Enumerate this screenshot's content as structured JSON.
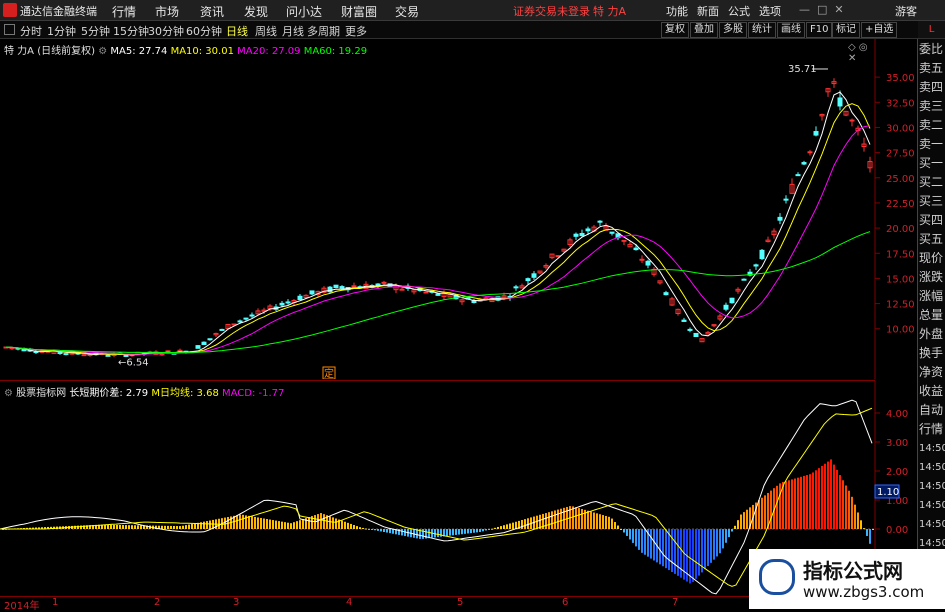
{
  "menubar": {
    "app_title": "通达信金融终端",
    "items": [
      "行情",
      "市场",
      "资讯",
      "发现",
      "问小达",
      "财富圈",
      "交易"
    ],
    "warning": "证券交易未登录",
    "stock": "特 力A",
    "right_items": [
      "功能",
      "新面",
      "公式",
      "选项"
    ],
    "guest": "游客",
    "window_buttons": [
      "—",
      "□",
      "✕"
    ]
  },
  "toolbar": {
    "periods": [
      "分时",
      "1分钟",
      "5分钟",
      "15分钟",
      "30分钟",
      "60分钟",
      "日线",
      "周线",
      "月线",
      "多周期",
      "更多"
    ],
    "active_period": "日线",
    "buttons": [
      "复权",
      "叠加",
      "多股",
      "统计",
      "画线",
      "F10",
      "标记",
      "+自选"
    ]
  },
  "main_chart": {
    "stock_label": "特 力A (日线前复权)",
    "ma5": "MA5: 27.74",
    "ma10": "MA10: 30.01",
    "ma20": "MA20: 27.09",
    "ma60": "MA60: 19.29",
    "high_label": "35.71",
    "low_label": "6.54",
    "marker": "定",
    "price_ticks": [
      "35.00",
      "32.50",
      "30.00",
      "27.50",
      "25.00",
      "22.50",
      "20.00",
      "17.50",
      "15.00",
      "12.50",
      "10.00"
    ]
  },
  "sub_chart": {
    "indicator": "股票指标网",
    "long_short": "长短期价差: 2.79",
    "m_avg": "M日均线: 3.68",
    "macd": "MACD: -1.77",
    "value_ticks": [
      "4.00",
      "3.00",
      "2.00",
      "1.00",
      "0.00"
    ],
    "right_value": "1.10"
  },
  "time_axis": {
    "year": "2014年",
    "months": [
      "1",
      "2",
      "3",
      "4",
      "5",
      "6",
      "7"
    ]
  },
  "right_panel": {
    "labels": [
      "委比",
      "卖五",
      "卖四",
      "卖三",
      "卖二",
      "卖一",
      "买一",
      "买二",
      "买三",
      "买四",
      "买五",
      "现价",
      "涨跌",
      "涨幅",
      "总量",
      "外盘",
      "换手",
      "净资",
      "收益",
      "自动",
      "行情",
      "14:50",
      "14:50",
      "14:50",
      "14:50",
      "14:50",
      "14:50",
      "14:50",
      "14:50"
    ]
  },
  "watermark": {
    "title": "指标公式网",
    "url": "www.zbgs3.com"
  },
  "colors": {
    "up": "#ff3232",
    "down": "#54ffff",
    "ma5": "#ffffff",
    "ma10": "#ffff00",
    "ma20": "#ff00ff",
    "ma60": "#00ff00"
  }
}
